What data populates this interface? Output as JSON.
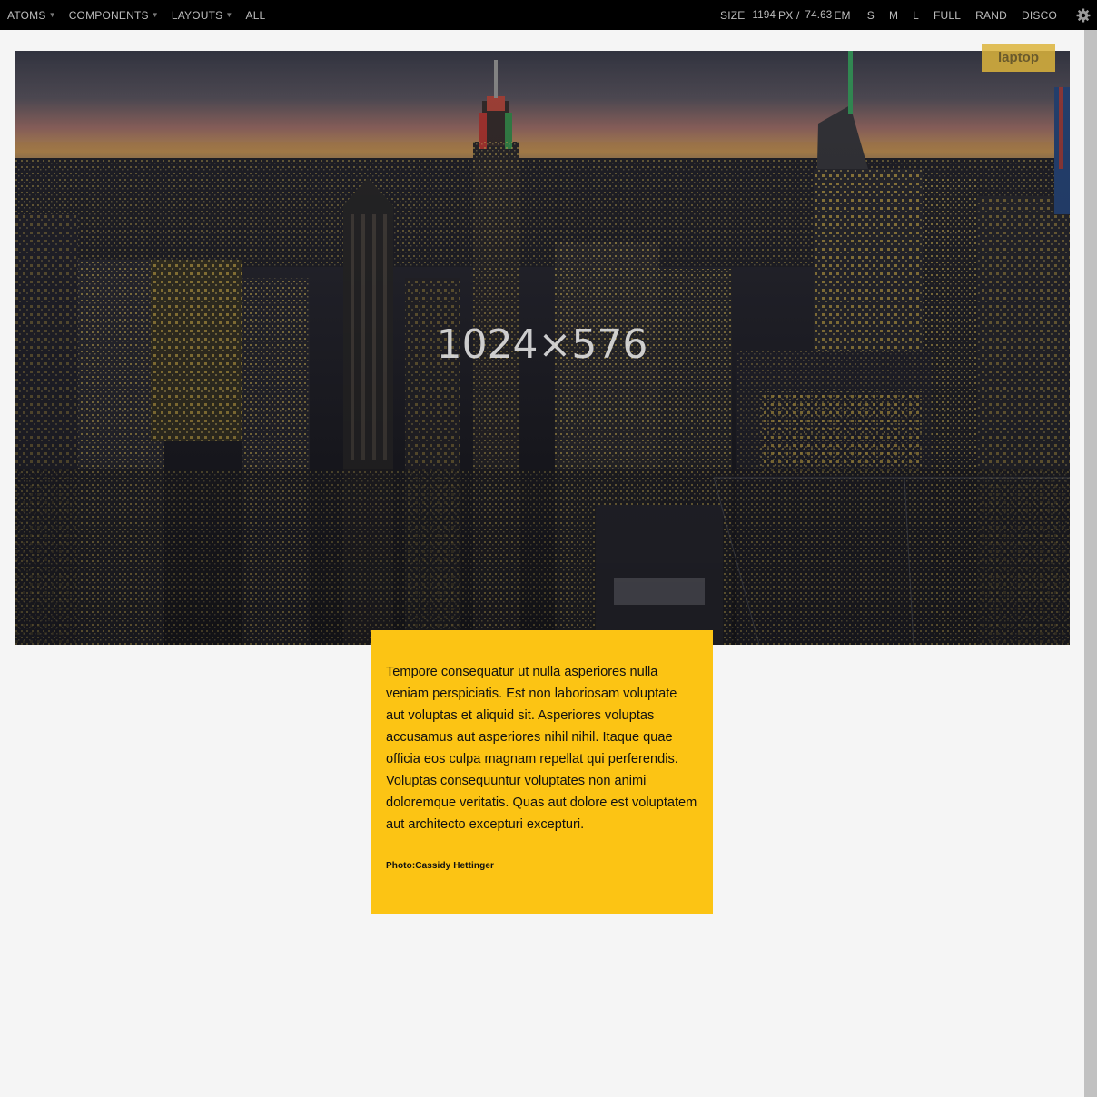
{
  "toolbar": {
    "menus": [
      {
        "label": "ATOMS"
      },
      {
        "label": "COMPONENTS"
      },
      {
        "label": "LAYOUTS"
      },
      {
        "label": "ALL"
      }
    ],
    "size_label": "SIZE",
    "size_px": "1194",
    "size_px_unit": "PX /",
    "size_em": "74.63",
    "size_em_unit": "EM",
    "viewport_buttons": {
      "s": "S",
      "m": "M",
      "l": "L",
      "full": "FULL",
      "rand": "RAND",
      "disco": "DISCO"
    },
    "gear_icon": "gear-icon"
  },
  "badge": {
    "label": "laptop",
    "color": "#dcb43c"
  },
  "hero": {
    "placeholder_text": "1024×576"
  },
  "caption": {
    "text": "Tempore consequatur ut nulla asperiores nulla veniam perspiciatis. Est non laboriosam voluptate aut voluptas et aliquid sit. Asperiores voluptas accusamus aut asperiores nihil nihil. Itaque quae officia eos culpa magnam repellat qui perferendis. Voluptas consequuntur voluptates non animi doloremque veritatis. Quas aut dolore est voluptatem aut architecto excepturi excepturi.",
    "credit": "Photo:Cassidy Hettinger",
    "background": "#fcc414"
  },
  "colors": {
    "toolbar_bg": "#000000",
    "page_bg": "#f5f5f5",
    "scrollbar_thumb": "#c1c1c1"
  }
}
